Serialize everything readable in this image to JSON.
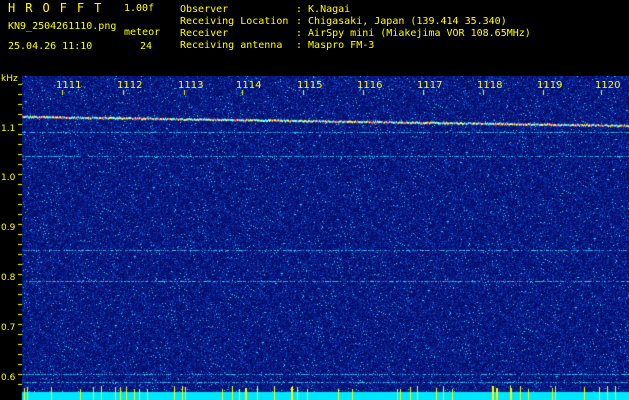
{
  "header": {
    "app_title": "HROFFT",
    "version": "1.00f",
    "filename": "KN9_2504261110.png",
    "meteor_label": "meteor",
    "datetime": "25.04.26 11:10",
    "count": "24"
  },
  "info": [
    {
      "label": "Observer",
      "value": ": K.Nagai"
    },
    {
      "label": "Receiving Location",
      "value": ": Chigasaki, Japan (139.414 35.340)"
    },
    {
      "label": "Receiver",
      "value": ": AirSpy mini (Miakejima VOR 108.65MHz)"
    },
    {
      "label": "Receiving antenna",
      "value": ": Maspro FM-3"
    }
  ],
  "axes": {
    "y_unit": "kHz",
    "y_ticks": [
      "1.1",
      "1.0",
      "0.9",
      "0.8",
      "0.7",
      "0.6"
    ],
    "x_ticks": [
      "1111",
      "1112",
      "1113",
      "1114",
      "1115",
      "1116",
      "1117",
      "1118",
      "1119",
      "1120"
    ]
  },
  "colors": {
    "text": "#ffff00",
    "background": "#000000",
    "noise": "#0a1a8a",
    "signal": "#00ffff"
  }
}
